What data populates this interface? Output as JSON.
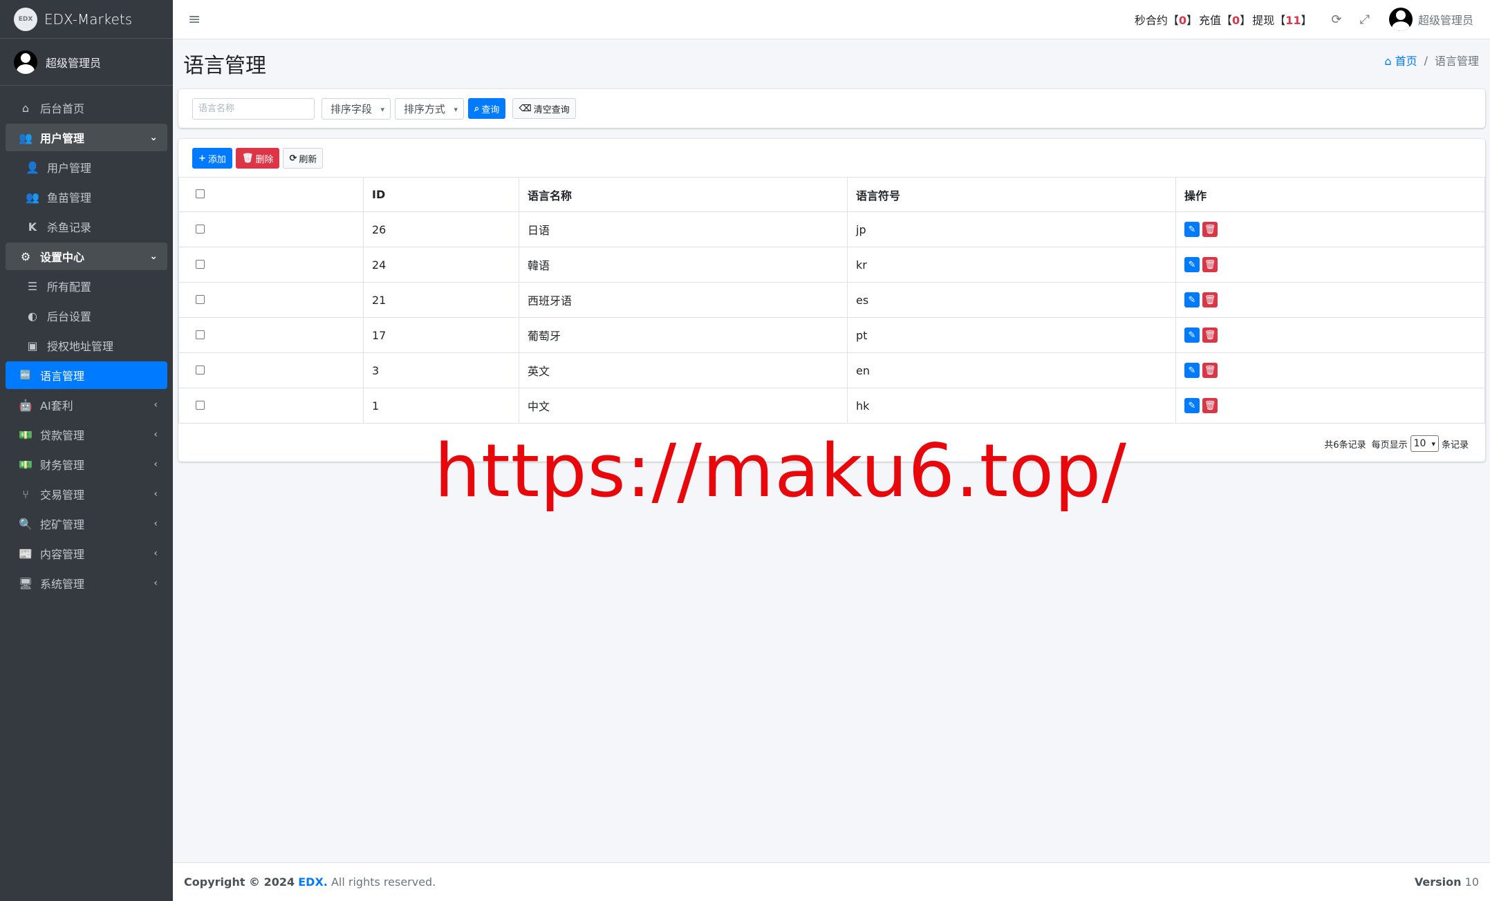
{
  "brand": {
    "logo_text": "EDX",
    "name": "EDX-Markets"
  },
  "sidebar": {
    "user": "超级管理员",
    "items": [
      {
        "label": "后台首页",
        "icon": "home-icon",
        "glyph": "⌂"
      },
      {
        "label": "用户管理",
        "icon": "users-icon",
        "glyph": "👥"
      },
      {
        "label": "用户管理",
        "icon": "user-icon",
        "glyph": "👤"
      },
      {
        "label": "鱼苗管理",
        "icon": "users-icon",
        "glyph": "👥"
      },
      {
        "label": "杀鱼记录",
        "icon": "k-icon",
        "glyph": "K"
      },
      {
        "label": "设置中心",
        "icon": "cogs-icon",
        "glyph": "⚙"
      },
      {
        "label": "所有配置",
        "icon": "list-icon",
        "glyph": "☰"
      },
      {
        "label": "后台设置",
        "icon": "adjust-icon",
        "glyph": "◐"
      },
      {
        "label": "授权地址管理",
        "icon": "id-card-icon",
        "glyph": "▣"
      },
      {
        "label": "语言管理",
        "icon": "language-icon",
        "glyph": "🔤"
      },
      {
        "label": "AI套利",
        "icon": "android-icon",
        "glyph": "🤖"
      },
      {
        "label": "贷款管理",
        "icon": "money-icon",
        "glyph": "💵"
      },
      {
        "label": "财务管理",
        "icon": "money-icon",
        "glyph": "💵"
      },
      {
        "label": "交易管理",
        "icon": "fork-icon",
        "glyph": "⑂"
      },
      {
        "label": "挖矿管理",
        "icon": "search-icon",
        "glyph": "🔍"
      },
      {
        "label": "内容管理",
        "icon": "newspaper-icon",
        "glyph": "📰"
      },
      {
        "label": "系统管理",
        "icon": "desktop-icon",
        "glyph": "🖥"
      }
    ]
  },
  "header": {
    "stat1_label": "秒合约【",
    "stat1_value": "0",
    "stat1_end": "】",
    "stat2_label": "充值【",
    "stat2_value": "0",
    "stat2_end": "】",
    "stat3_label": "提现【",
    "stat3_value": "11",
    "stat3_end": "】",
    "user": "超级管理员"
  },
  "page": {
    "title": "语言管理"
  },
  "breadcrumb": {
    "home": "首页",
    "current": "语言管理"
  },
  "search": {
    "placeholder": "语言名称",
    "sort_field": "排序字段",
    "sort_order": "排序方式",
    "query": "查询",
    "clear": "清空查询"
  },
  "toolbar": {
    "add": "添加",
    "delete": "删除",
    "refresh": "刷新"
  },
  "table": {
    "headers": [
      "ID",
      "语言名称",
      "语言符号",
      "操作"
    ],
    "rows": [
      {
        "id": "26",
        "name": "日语",
        "code": "jp"
      },
      {
        "id": "24",
        "name": "韓语",
        "code": "kr"
      },
      {
        "id": "21",
        "name": "西班牙语",
        "code": "es"
      },
      {
        "id": "17",
        "name": "葡萄牙",
        "code": "pt"
      },
      {
        "id": "3",
        "name": "英文",
        "code": "en"
      },
      {
        "id": "1",
        "name": "中文",
        "code": "hk"
      }
    ]
  },
  "pagination": {
    "total": "共6条记录",
    "per_page_label": "每页显示",
    "per_page": "10",
    "suffix": "条记录"
  },
  "watermark": "https://maku6.top/",
  "footer": {
    "copyright": "Copyright © 2024",
    "brand": "EDX.",
    "rights": "All rights reserved.",
    "version_label": "Version",
    "version": "10"
  },
  "colors": {
    "sidebar_bg": "#343a40",
    "primary": "#007bff",
    "danger": "#dc3545",
    "watermark": "#e8080c"
  }
}
